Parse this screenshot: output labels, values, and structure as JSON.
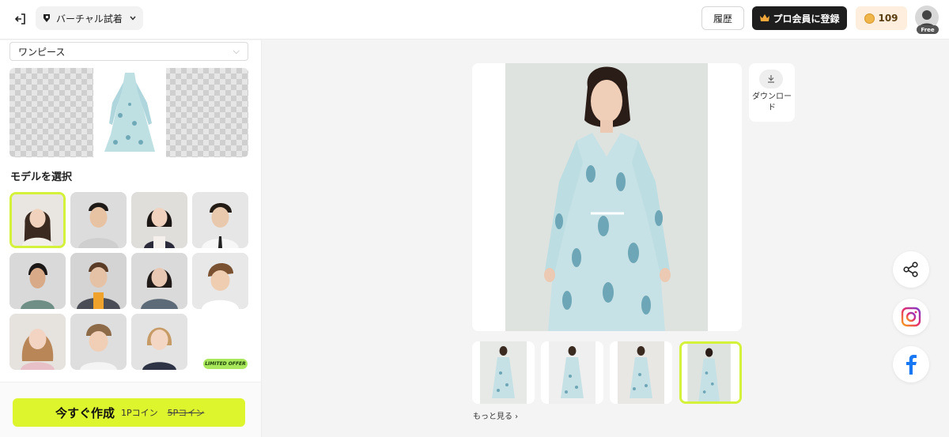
{
  "header": {
    "tool_name": "バーチャル試着",
    "history_label": "履歴",
    "pro_label": "プロ会員に登録",
    "coin_count": "109",
    "plan_badge": "Free"
  },
  "left_panel": {
    "category_value": "ワンピース",
    "section_title": "モデルを選択",
    "models": [
      {
        "name": "model-woman-1",
        "selected": true
      },
      {
        "name": "model-man-1",
        "selected": false
      },
      {
        "name": "model-woman-2",
        "selected": false
      },
      {
        "name": "model-man-2",
        "selected": false
      },
      {
        "name": "model-woman-3",
        "selected": false
      },
      {
        "name": "model-man-3",
        "selected": false
      },
      {
        "name": "model-woman-4",
        "selected": false
      },
      {
        "name": "model-boy-1",
        "selected": false
      },
      {
        "name": "model-girl-1",
        "selected": false
      },
      {
        "name": "model-boy-2",
        "selected": false
      },
      {
        "name": "model-girl-2",
        "selected": false
      }
    ],
    "cta_label": "今すぐ作成",
    "cta_cost": "1Pコイン",
    "cta_old_cost": "5Pコイン",
    "limited_offer": "LIMITED OFFER"
  },
  "main": {
    "download_label": "ダウンロード",
    "more_link": "もっと見る ›",
    "thumbnails": [
      {
        "selected": false
      },
      {
        "selected": false
      },
      {
        "selected": false
      },
      {
        "selected": true
      }
    ]
  },
  "colors": {
    "accent": "#ddf52d",
    "pro_bg": "#1e1e1e",
    "coin_bg": "#fdeedd"
  }
}
